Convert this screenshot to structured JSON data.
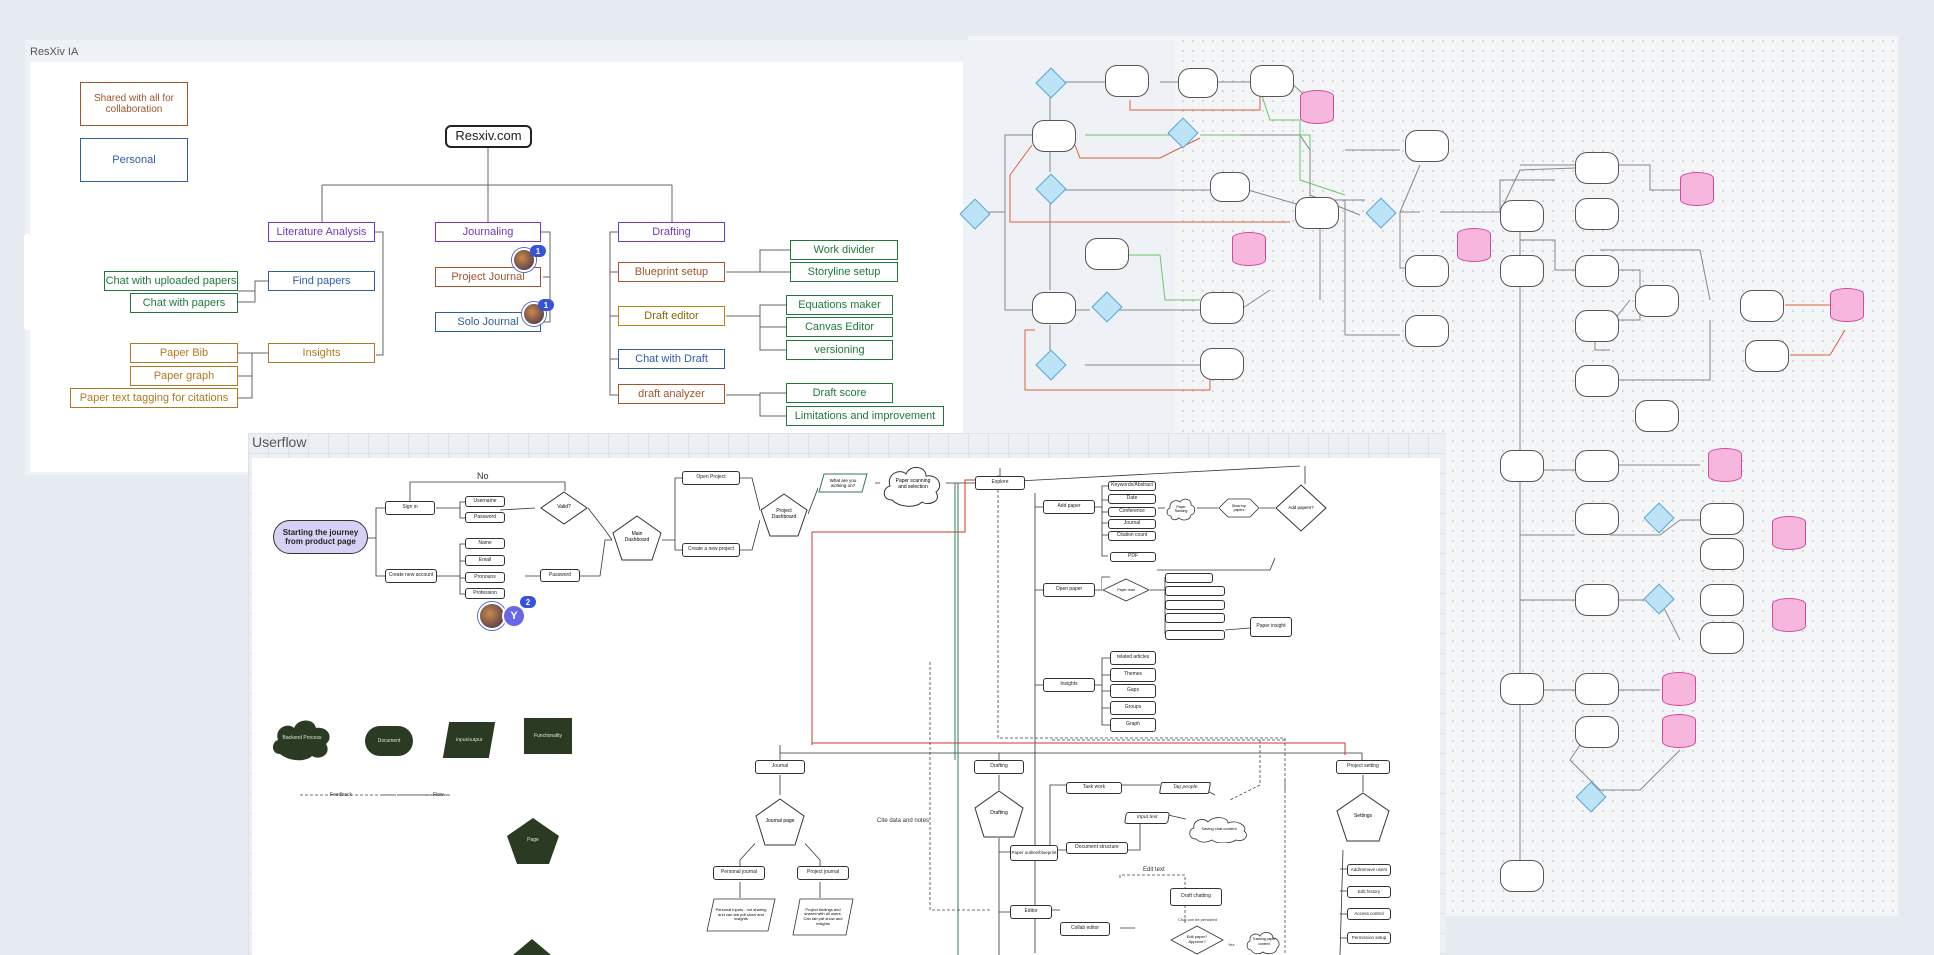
{
  "frames": {
    "ia_label": "ResXiv IA",
    "userflow_label": "Userflow"
  },
  "legend_ia": {
    "shared": "Shared with all for collaboration",
    "personal": "Personal"
  },
  "ia": {
    "root": "Resxiv.com",
    "literature_analysis": "Literature Analysis",
    "find_papers": "Find papers",
    "chat_uploaded": "Chat with uploaded papers",
    "chat_papers": "Chat with papers",
    "insights": "Insights",
    "paper_bib": "Paper Bib",
    "paper_graph": "Paper graph",
    "paper_text_tagging": "Paper text tagging for citations",
    "journaling": "Journaling",
    "project_journal": "Project Journal",
    "solo_journal": "Solo Journal",
    "drafting": "Drafting",
    "blueprint_setup": "Blueprint setup",
    "work_divider": "Work divider",
    "storyline_setup": "Storyline setup",
    "draft_editor": "Draft editor",
    "equations_maker": "Equations maker",
    "canvas_editor": "Canvas Editor",
    "versioning": "versioning",
    "chat_with_draft": "Chat with Draft",
    "draft_analyzer": "draft analyzer",
    "draft_score": "Draft score",
    "limitations": "Limitations and improvement"
  },
  "badges": {
    "project_journal_count": "1",
    "solo_journal_count": "1",
    "userflow_count": "2",
    "userflow_avatar_letter": "Y"
  },
  "userflow": {
    "start": "Starting the journey from product page",
    "no_label": "No",
    "sign_in": "Sign in",
    "username": "Username",
    "password": "Password",
    "valid": "Valid?",
    "create_account": "Create new account",
    "name": "Name",
    "email": "Email",
    "pronouns": "Pronouns",
    "profession": "Profession",
    "password2": "Password",
    "main_dashboard": "Main Dashboard",
    "open_project": "Open Project",
    "create_project": "Create a new project",
    "project_dashboard": "Project Dashboard",
    "what_working": "What are you working on?",
    "paper_scanning": "Paper scanning and selection",
    "explore": "Explore",
    "add_paper": "Add paper",
    "keywords": "Keywords/Abstract",
    "date": "Date",
    "conference": "Conference",
    "journal_src": "Journal",
    "citation": "Citation count",
    "paper_ranking": "Paper Ranking",
    "show_top": "Show top papers",
    "add_papers_q": "Add papers?",
    "pdf": "PDF",
    "open_paper": "Open paper",
    "paper_read": "Paper read",
    "insights": "Insights",
    "related": "related articles",
    "themes": "Themes",
    "gaps": "Gaps",
    "groups": "Groups",
    "graph": "Graph",
    "paper_insight": "Paper insight",
    "journal": "Journal",
    "journal_page": "Journal page",
    "personal_journal": "Personal journal",
    "project_journal": "Project journal",
    "personal_inputs": "Personal inputs - not sharing and can tab pdf show and insights",
    "project_findings": "Project findings and shared with all users. Can tab pdf show and insights",
    "drafting": "Drafting",
    "drafting_page": "Drafting",
    "cite_data": "Cite data and notes",
    "paper_outline": "Paper outline/blueprint",
    "editor": "Editor",
    "collab_editor": "Collab editor",
    "task_work": "Task work",
    "tag_people": "Tag people",
    "input_text": "Input text",
    "document_structure": "Document structure",
    "saving_chat": "Saving chat content",
    "edit_text": "Edit text",
    "draft_chatting": "Draft chatting",
    "chat_persisted": "Chat can be persisted",
    "edit_paper_q": "Edit paper? Approve?",
    "yes": "Yes",
    "tracking": "Tracking paper content",
    "project_setting": "Project setting",
    "settings": "Settings",
    "add_members": "Add/remove users",
    "edit_history": "Edit history",
    "access_control": "Access control",
    "permission": "Permission setup",
    "legend_feedback": "Feedback",
    "legend_flow": "Flow",
    "legend_backend": "Backend Process",
    "legend_document": "Document",
    "legend_input": "Input/output",
    "legend_functionality": "Functionality",
    "legend_page": "Page"
  },
  "colors": {
    "purple": "#6f3ac4",
    "blue": "#2f5da8",
    "green": "#1f7a3a",
    "orange": "#b07920",
    "brown": "#a0552a",
    "flow_red": "#e0603c",
    "flow_green": "#6cc46c",
    "db_pink": "#f7b6de",
    "decision_blue": "#bde3f7",
    "legend_dark": "#2a3a23"
  }
}
